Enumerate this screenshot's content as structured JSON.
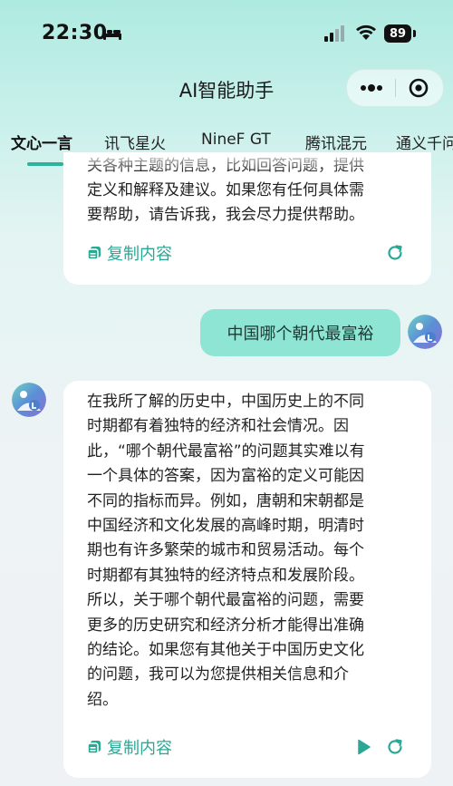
{
  "status_bar": {
    "time": "22:30",
    "battery": "89"
  },
  "title_bar": {
    "title": "AI智能助手"
  },
  "tabs": [
    {
      "label": "文心一言",
      "active": true
    },
    {
      "label": "讯飞星火",
      "active": false
    },
    {
      "label": "NineF GT",
      "active": false
    },
    {
      "label": "腾讯混元",
      "active": false
    },
    {
      "label": "通义千问",
      "active": false
    }
  ],
  "messages": {
    "prev_answer": {
      "lines": [
        "关各种主题的信息，比如回答问题，提供",
        "定义和解释及建议。如果您有任何具体需",
        "要帮助，请告诉我，我会尽力提供帮助。"
      ],
      "copy_label": "复制内容"
    },
    "user_question": "中国哪个朝代最富裕",
    "answer": {
      "lines": [
        "在我所了解的历史中，中国历史上的不同",
        "时期都有着独特的经济和社会情况。因",
        "此，“哪个朝代最富裕”的问题其实难以有",
        "一个具体的答案，因为富裕的定义可能因",
        "不同的指标而异。例如，唐朝和宋朝都是",
        "中国经济和文化发展的高峰时期，明清时",
        "期也有许多繁荣的城市和贸易活动。每个",
        "时期都有其独特的经济特点和发展阶段。",
        "所以，关于哪个朝代最富裕的问题，需要",
        "更多的历史研究和经济分析才能得出准确",
        "的结论。如果您有其他关于中国历史文化",
        "的问题，我可以为您提供相关信息和介",
        "绍。"
      ],
      "copy_label": "复制内容"
    }
  },
  "colors": {
    "accent": "#2aa894",
    "user_bubble": "#8ee5d4"
  },
  "icons": {
    "copy": "copy-icon",
    "refresh": "refresh-icon",
    "play": "play-icon",
    "more": "more-icon",
    "close": "close-circle-icon"
  }
}
